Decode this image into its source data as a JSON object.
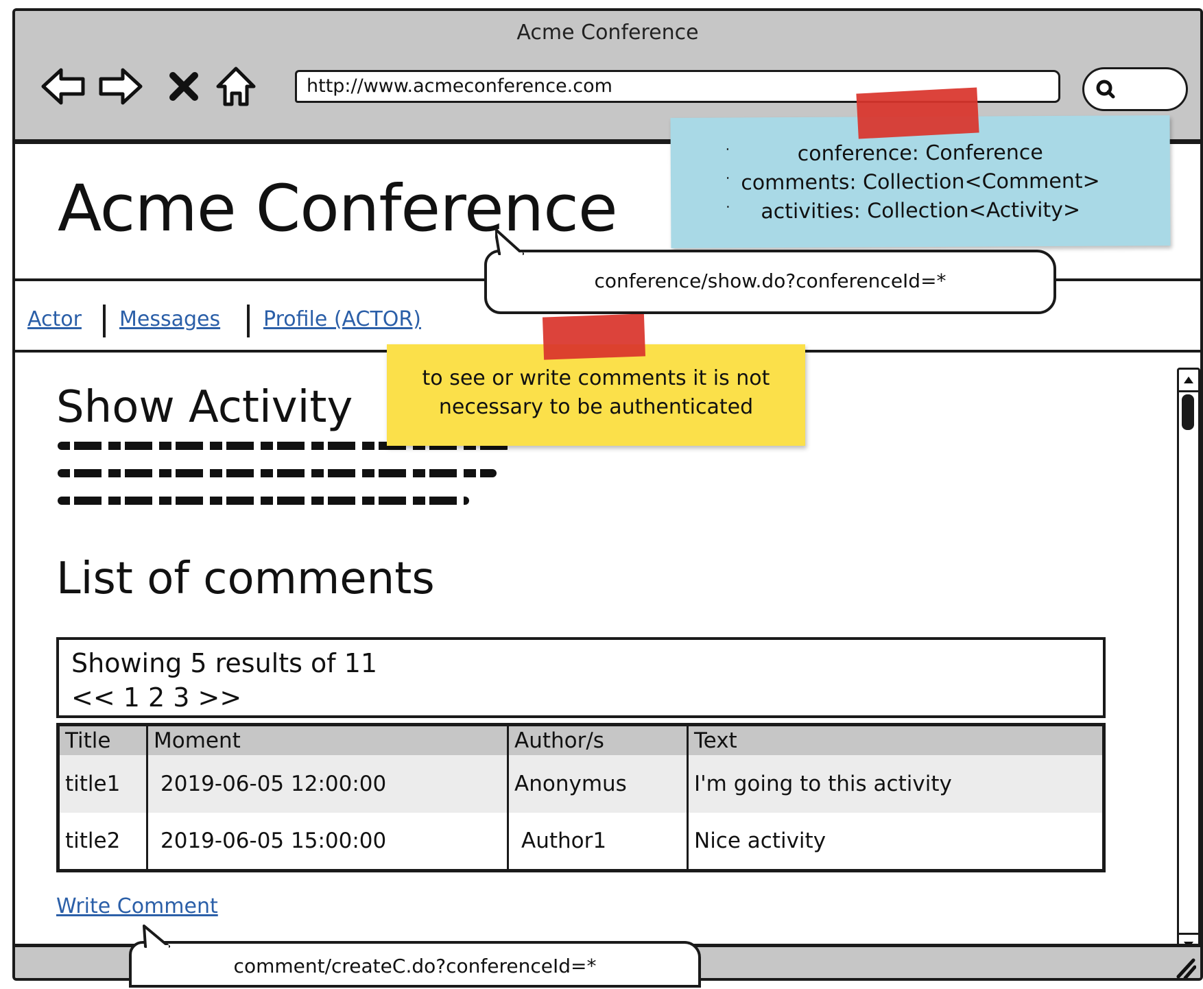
{
  "browser": {
    "window_title": "Acme Conference",
    "url": "http://www.acmeconference.com",
    "icons": [
      "back-arrow-icon",
      "forward-arrow-icon",
      "stop-x-icon",
      "home-icon",
      "search-icon"
    ]
  },
  "header": {
    "site_title": "Acme Conference"
  },
  "nav": {
    "items": [
      {
        "label": "Actor"
      },
      {
        "label": "Messages"
      },
      {
        "label": "Profile (ACTOR)"
      }
    ]
  },
  "main": {
    "show_heading": "Show Activity",
    "list_heading": "List of comments",
    "pager": {
      "summary": "Showing 5 results of 11",
      "links": "<< 1 2 3 >>"
    },
    "table": {
      "columns": [
        "Title",
        "Moment",
        "Author/s",
        "Text"
      ],
      "rows": [
        [
          "title1",
          "2019-06-05 12:00:00",
          "Anonymus",
          "I'm going to this activity"
        ],
        [
          "title2",
          "2019-06-05 15:00:00",
          "Author1",
          "Nice activity"
        ]
      ]
    },
    "write_comment_link": "Write Comment"
  },
  "annotations": {
    "model_note": {
      "lines": [
        "conference: Conference",
        "comments: Collection<Comment>",
        "activities: Collection<Activity>"
      ]
    },
    "auth_note": {
      "lines": [
        "to see or write comments it is not",
        "necessary to be authenticated"
      ]
    },
    "title_callout": "conference/show.do?conferenceId=*",
    "write_comment_callout": "comment/createC.do?conferenceId=*"
  },
  "colors": {
    "chrome_gray": "#c6c6c6",
    "link_blue": "#2b5fa8",
    "blue_sticky": "#a9d9e6",
    "yellow_sticky": "#fbe04a",
    "red_tape": "#d9352c"
  }
}
